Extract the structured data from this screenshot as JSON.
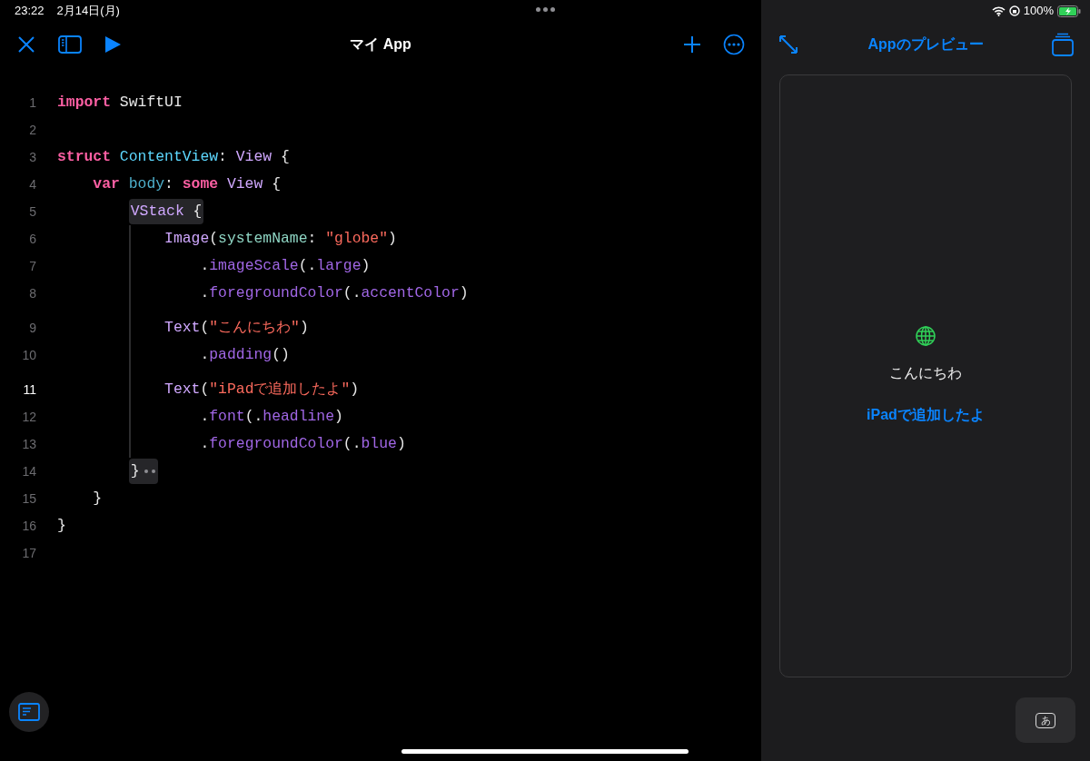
{
  "status_bar": {
    "time": "23:22",
    "date": "2月14日(月)",
    "battery": "100%"
  },
  "editor": {
    "title": "マイ App",
    "lines": [
      {
        "number": "1",
        "current": false,
        "spaced": false,
        "guide": false,
        "folded": false,
        "tokens": [
          {
            "text": "import",
            "kind": "keyword"
          },
          {
            "text": " SwiftUI",
            "kind": "plain"
          }
        ]
      },
      {
        "number": "2",
        "current": false,
        "spaced": false,
        "guide": false,
        "folded": false
      },
      {
        "number": "3",
        "current": false,
        "spaced": false,
        "guide": false,
        "folded": false,
        "tokens": [
          {
            "text": "struct",
            "kind": "keyword"
          },
          {
            "text": " ContentView",
            "kind": "decl"
          },
          {
            "text": ": ",
            "kind": "plain"
          },
          {
            "text": "View",
            "kind": "type"
          },
          {
            "text": " {",
            "kind": "plain"
          }
        ],
        "children": [
          {
            "number": "4",
            "current": false,
            "spaced": false,
            "guide": false,
            "folded": false,
            "tokens": [
              {
                "text": "var",
                "kind": "keyword"
              },
              {
                "text": " body",
                "kind": "property"
              },
              {
                "text": ": ",
                "kind": "plain"
              },
              {
                "text": "some",
                "kind": "keyword"
              },
              {
                "text": " View",
                "kind": "type"
              },
              {
                "text": " {",
                "kind": "plain"
              }
            ],
            "children": [
              {
                "number": "5",
                "current": false,
                "spaced": false,
                "guide": true,
                "folded": false,
                "boxed": [
                  {
                    "text": "VStack",
                    "kind": "type"
                  },
                  {
                    "text": " {",
                    "kind": "plain"
                  }
                ],
                "children": [
                  {
                    "number": "6",
                    "current": false,
                    "spaced": false,
                    "guide": false,
                    "folded": false,
                    "tokens": [
                      {
                        "text": "Image",
                        "kind": "type"
                      },
                      {
                        "text": "(",
                        "kind": "plain"
                      },
                      {
                        "text": "systemName",
                        "kind": "label"
                      },
                      {
                        "text": ": ",
                        "kind": "plain"
                      },
                      {
                        "text": "\"globe\"",
                        "kind": "string"
                      },
                      {
                        "text": ")",
                        "kind": "plain"
                      }
                    ],
                    "children": [
                      {
                        "number": "7",
                        "current": false,
                        "spaced": false,
                        "guide": false,
                        "folded": false,
                        "tokens": [
                          {
                            "text": ".",
                            "kind": "plain"
                          },
                          {
                            "text": "imageScale",
                            "kind": "method"
                          },
                          {
                            "text": "(.",
                            "kind": "plain"
                          },
                          {
                            "text": "large",
                            "kind": "method"
                          },
                          {
                            "text": ")",
                            "kind": "plain"
                          }
                        ]
                      },
                      {
                        "number": "8",
                        "current": false,
                        "spaced": false,
                        "guide": false,
                        "folded": false,
                        "tokens": [
                          {
                            "text": ".",
                            "kind": "plain"
                          },
                          {
                            "text": "foregroundColor",
                            "kind": "method"
                          },
                          {
                            "text": "(.",
                            "kind": "plain"
                          },
                          {
                            "text": "accentColor",
                            "kind": "method"
                          },
                          {
                            "text": ")",
                            "kind": "plain"
                          }
                        ]
                      }
                    ]
                  },
                  {
                    "number": "9",
                    "current": false,
                    "spaced": true,
                    "guide": false,
                    "folded": false,
                    "tokens": [
                      {
                        "text": "Text",
                        "kind": "type"
                      },
                      {
                        "text": "(",
                        "kind": "plain"
                      },
                      {
                        "text": "\"こんにちわ\"",
                        "kind": "string"
                      },
                      {
                        "text": ")",
                        "kind": "plain"
                      }
                    ],
                    "children": [
                      {
                        "number": "10",
                        "current": false,
                        "spaced": false,
                        "guide": false,
                        "folded": false,
                        "tokens": [
                          {
                            "text": ".",
                            "kind": "plain"
                          },
                          {
                            "text": "padding",
                            "kind": "method"
                          },
                          {
                            "text": "()",
                            "kind": "plain"
                          }
                        ]
                      }
                    ]
                  },
                  {
                    "number": "11",
                    "current": true,
                    "spaced": true,
                    "guide": false,
                    "folded": false,
                    "tokens": [
                      {
                        "text": "Text",
                        "kind": "type"
                      },
                      {
                        "text": "(",
                        "kind": "plain"
                      },
                      {
                        "text": "\"iPadで追加したよ\"",
                        "kind": "string"
                      },
                      {
                        "text": ")",
                        "kind": "plain"
                      }
                    ],
                    "children": [
                      {
                        "number": "12",
                        "current": false,
                        "spaced": false,
                        "guide": false,
                        "folded": false,
                        "tokens": [
                          {
                            "text": ".",
                            "kind": "plain"
                          },
                          {
                            "text": "font",
                            "kind": "method"
                          },
                          {
                            "text": "(.",
                            "kind": "plain"
                          },
                          {
                            "text": "headline",
                            "kind": "method"
                          },
                          {
                            "text": ")",
                            "kind": "plain"
                          }
                        ]
                      },
                      {
                        "number": "13",
                        "current": false,
                        "spaced": false,
                        "guide": false,
                        "folded": false,
                        "tokens": [
                          {
                            "text": ".",
                            "kind": "plain"
                          },
                          {
                            "text": "foregroundColor",
                            "kind": "method"
                          },
                          {
                            "text": "(.",
                            "kind": "plain"
                          },
                          {
                            "text": "blue",
                            "kind": "method"
                          },
                          {
                            "text": ")",
                            "kind": "plain"
                          }
                        ]
                      }
                    ]
                  }
                ]
              },
              {
                "number": "14",
                "current": false,
                "spaced": false,
                "guide": false,
                "folded": true,
                "boxed": [
                  {
                    "text": "}",
                    "kind": "plain"
                  }
                ]
              }
            ]
          },
          {
            "number": "15",
            "current": false,
            "spaced": false,
            "guide": false,
            "folded": false,
            "tokens": [
              {
                "text": "}",
                "kind": "plain"
              }
            ]
          }
        ]
      },
      {
        "number": "16",
        "current": false,
        "spaced": false,
        "guide": false,
        "folded": false,
        "tokens": [
          {
            "text": "}",
            "kind": "plain"
          }
        ]
      },
      {
        "number": "17",
        "current": false,
        "spaced": false,
        "guide": false,
        "folded": false
      }
    ]
  },
  "preview": {
    "title": "Appのプレビュー",
    "greeting": "こんにちわ",
    "headline": "iPadで追加したよ",
    "keyboard_key": "あ"
  }
}
